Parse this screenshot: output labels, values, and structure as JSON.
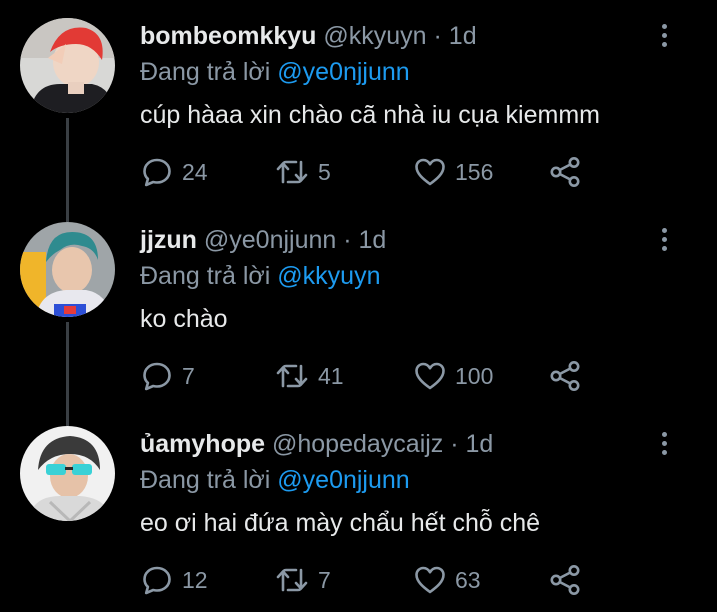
{
  "colors": {
    "background": "#000000",
    "text": "#e7e9ea",
    "muted": "#8b98a5",
    "accent": "#1d9bf0",
    "thread_line": "#3a3f44"
  },
  "tweets": [
    {
      "display_name": "bombeomkkyu",
      "handle": "@kkyuyn",
      "dot": " · ",
      "time": "1d",
      "reply_prefix": "Đang trả lời ",
      "reply_to": "@ye0njjunn",
      "text": "cúp hàaa xin chào cã nhà iu cụa kiemmm",
      "replies": "24",
      "retweets": "5",
      "likes": "156",
      "avatar_icon": "profile-photo-red-hair",
      "more_icon": "more-vertical-icon"
    },
    {
      "display_name": "jjzun",
      "handle": "@ye0njjunn",
      "dot": " · ",
      "time": "1d",
      "reply_prefix": "Đang trả lời ",
      "reply_to": "@kkyuyn",
      "text": "ko chào",
      "replies": "7",
      "retweets": "41",
      "likes": "100",
      "avatar_icon": "profile-photo-teal-hair",
      "more_icon": "more-vertical-icon"
    },
    {
      "display_name": "ủamyhope",
      "handle": "@hopedaycaijz",
      "dot": " · ",
      "time": "1d",
      "reply_prefix": "Đang trả lời ",
      "reply_to": "@ye0njjunn",
      "text": "eo ơi hai đứa mày chẩu hết chỗ chê",
      "replies": "12",
      "retweets": "7",
      "likes": "63",
      "avatar_icon": "profile-photo-sunglasses",
      "more_icon": "more-vertical-icon"
    }
  ],
  "action_icons": [
    "reply-icon",
    "retweet-icon",
    "like-icon",
    "share-icon"
  ]
}
